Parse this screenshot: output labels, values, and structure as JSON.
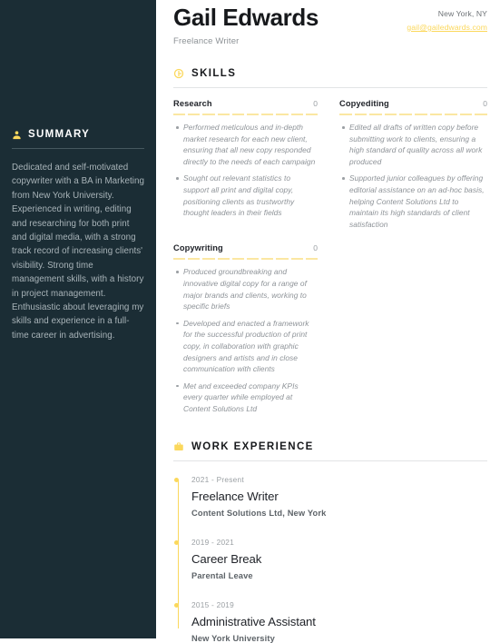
{
  "accent_color": "#fbd85c",
  "sidebar_bg": "#1b2d35",
  "header": {
    "name": "Gail Edwards",
    "job_title": "Freelance Writer",
    "location": "New York, NY",
    "email": "gail@gailedwards.com"
  },
  "sidebar": {
    "summary": {
      "icon": "person-icon",
      "title": "SUMMARY",
      "text": "Dedicated and self-motivated copywriter with a BA in Marketing from New York University. Experienced in writing, editing and researching for both print and digital media, with a strong track record of increasing clients' visibility. Strong time management skills, with a history in project management. Enthusiastic about leveraging my skills and experience in a full-time career in advertising."
    }
  },
  "skills_section": {
    "icon": "lightbulb-icon",
    "title": "SKILLS",
    "rating_segments": 10,
    "items": [
      {
        "name": "Research",
        "level": "0",
        "filled": 0,
        "bullets": [
          "Performed meticulous and in-depth market research for each new client, ensuring that all new copy responded directly to the needs of each campaign",
          "Sought out relevant statistics to support all print and digital copy, positioning clients as trustworthy thought leaders in their fields"
        ]
      },
      {
        "name": "Copyediting",
        "level": "0",
        "filled": 0,
        "bullets": [
          "Edited all drafts of written copy before submitting work to clients, ensuring a high standard of quality across all work produced",
          "Supported junior colleagues by offering editorial assistance on an ad-hoc basis, helping Content Solutions Ltd to maintain its high standards of client satisfaction"
        ]
      },
      {
        "name": "Copywriting",
        "level": "0",
        "filled": 0,
        "bullets": [
          "Produced groundbreaking and innovative digital copy for a range of major brands and clients, working to specific briefs",
          "Developed and enacted a framework for the successful production of print copy, in collaboration with graphic designers and artists and in close communication with clients",
          "Met and exceeded company KPIs every quarter while employed at Content Solutions Ltd"
        ]
      }
    ]
  },
  "work_section": {
    "icon": "briefcase-icon",
    "title": "WORK EXPERIENCE",
    "entries": [
      {
        "date": "2021 - Present",
        "role": "Freelance Writer",
        "organization": "Content Solutions Ltd, New York"
      },
      {
        "date": "2019 - 2021",
        "role": "Career Break",
        "organization": "Parental Leave"
      },
      {
        "date": "2015 - 2019",
        "role": "Administrative Assistant",
        "organization": "New York University"
      }
    ]
  }
}
